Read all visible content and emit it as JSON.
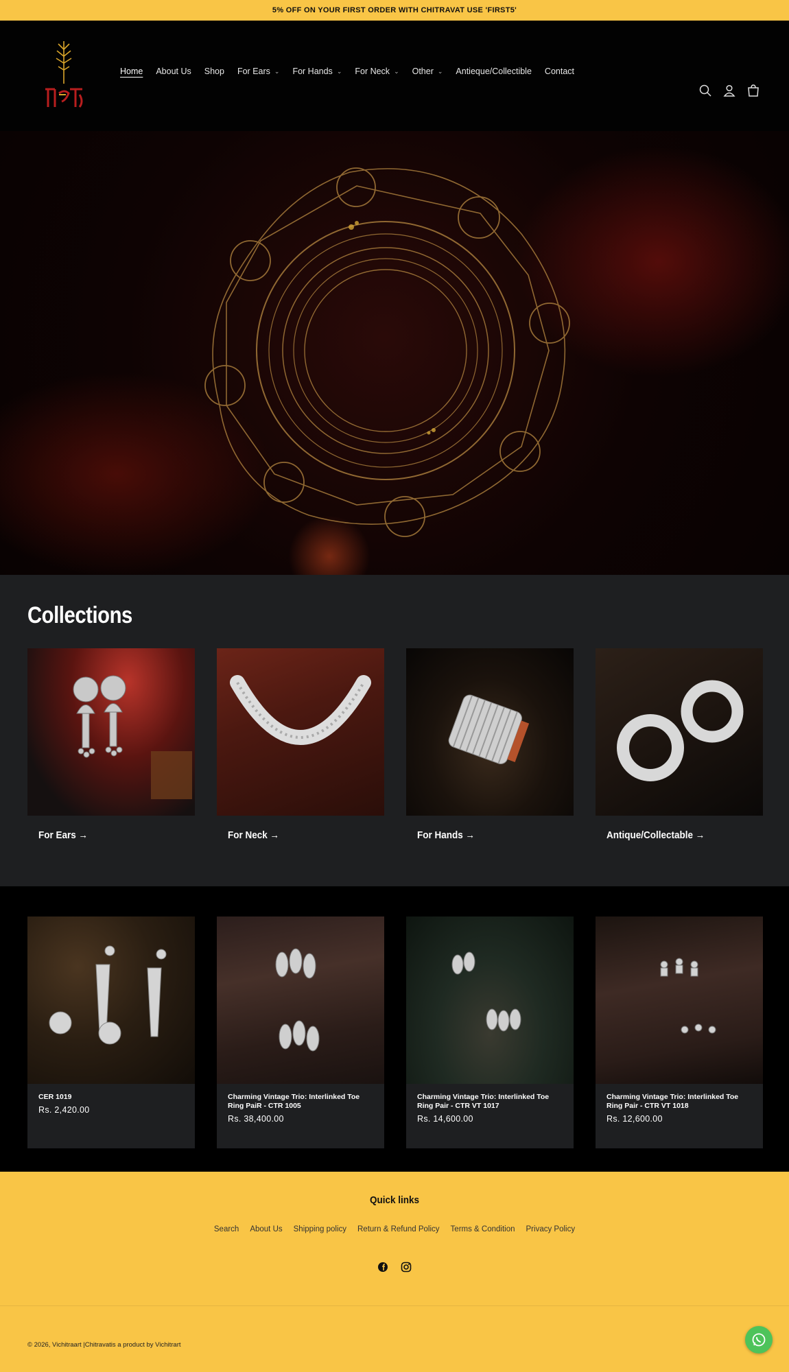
{
  "announcement": "5% OFF ON YOUR FIRST ORDER WITH CHITRAVAT USE 'FIRST5'",
  "header": {
    "logo_text": "चित्रवत",
    "nav": [
      {
        "label": "Home",
        "active": true,
        "dropdown": false
      },
      {
        "label": "About Us",
        "dropdown": false
      },
      {
        "label": "Shop",
        "dropdown": false
      },
      {
        "label": "For Ears",
        "dropdown": true
      },
      {
        "label": "For Hands",
        "dropdown": true
      },
      {
        "label": "For Neck",
        "dropdown": true
      },
      {
        "label": "Other",
        "dropdown": true
      },
      {
        "label": "Antieque/Collectible",
        "dropdown": false
      },
      {
        "label": "Contact",
        "dropdown": false
      }
    ],
    "icons": [
      "search-icon",
      "account-icon",
      "cart-icon"
    ]
  },
  "collections": {
    "title": "Collections",
    "items": [
      {
        "label": "For Ears →"
      },
      {
        "label": "For Neck →"
      },
      {
        "label": "For Hands →"
      },
      {
        "label": "Antique/Collectable →"
      }
    ]
  },
  "products": [
    {
      "title": "CER 1019",
      "price": "Rs. 2,420.00"
    },
    {
      "title": "Charming Vintage Trio: Interlinked Toe Ring PaiR - CTR 1005",
      "price": "Rs. 38,400.00"
    },
    {
      "title": "Charming Vintage Trio: Interlinked Toe Ring Pair - CTR VT 1017",
      "price": "Rs. 14,600.00"
    },
    {
      "title": "Charming Vintage Trio: Interlinked Toe Ring Pair - CTR VT 1018",
      "price": "Rs. 12,600.00"
    }
  ],
  "footer": {
    "quick_links_title": "Quick links",
    "links": [
      "Search",
      "About Us",
      "Shipping policy",
      "Return & Refund Policy",
      "Terms & Condition",
      "Privacy Policy"
    ],
    "social": [
      "facebook-icon",
      "instagram-icon"
    ],
    "copyright": "© 2026, Vichitraart |Chitravatis a product by Vichitrart"
  },
  "colors": {
    "accent": "#f9c546",
    "whatsapp": "#4dc35a",
    "section_bg": "#1e1f21"
  }
}
